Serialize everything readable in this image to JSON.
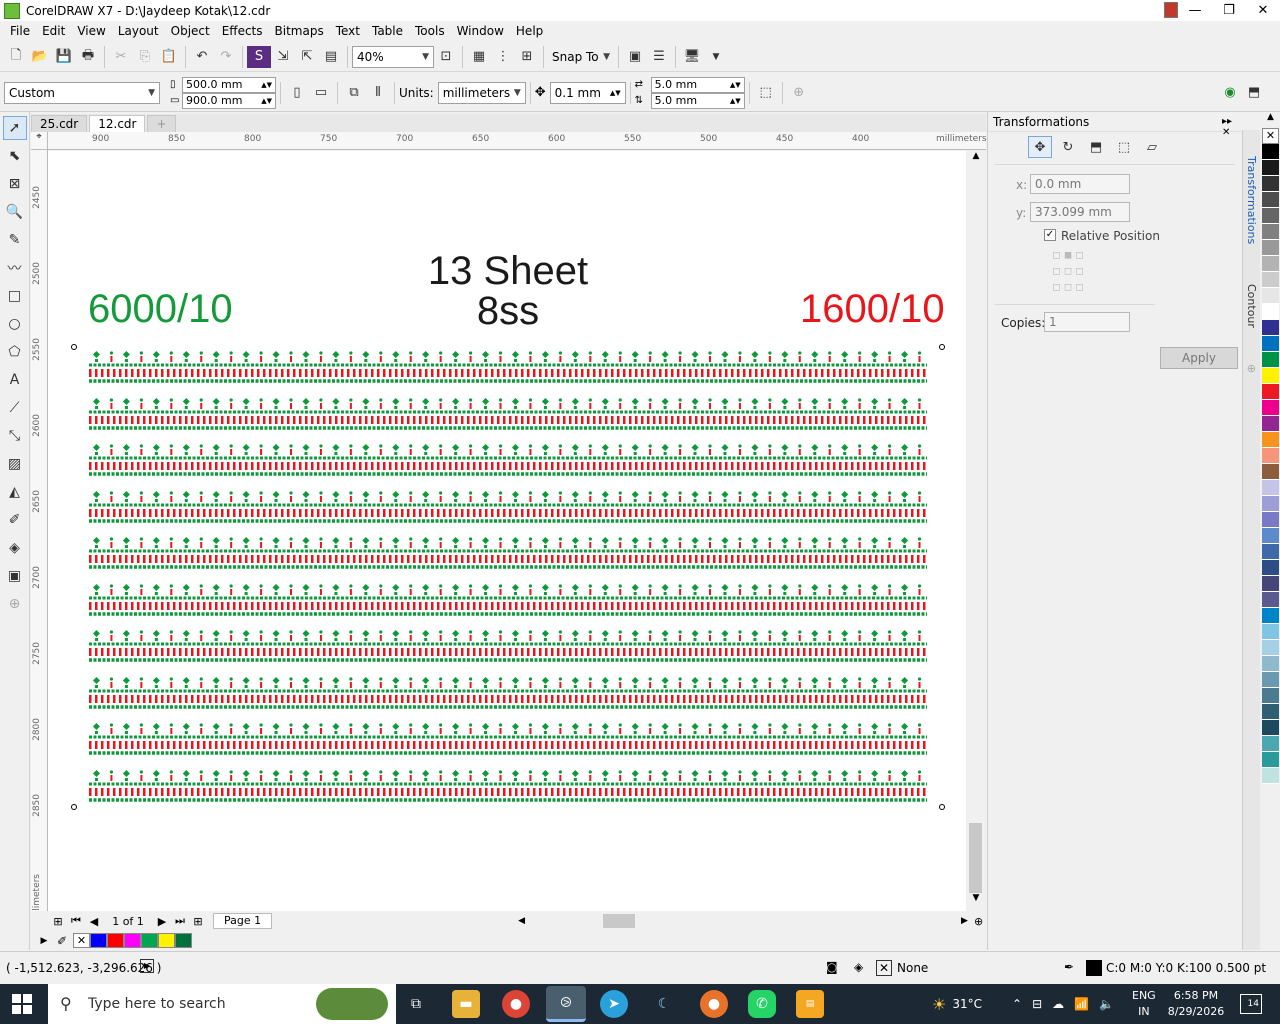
{
  "window": {
    "title": "CorelDRAW X7 - D:\\Jaydeep Kotak\\12.cdr",
    "minimize_glyph": "—",
    "restore_glyph": "❐",
    "close_glyph": "✕"
  },
  "menu": [
    "File",
    "Edit",
    "View",
    "Layout",
    "Object",
    "Effects",
    "Bitmaps",
    "Text",
    "Table",
    "Tools",
    "Window",
    "Help"
  ],
  "toolbar1": {
    "zoom_value": "40%",
    "snap_to_label": "Snap To"
  },
  "toolbar2": {
    "page_preset": "Custom",
    "page_width": "500.0 mm",
    "page_height": "900.0 mm",
    "units_label": "Units:",
    "units_value": "millimeters",
    "nudge_value": "0.1 mm",
    "dup_x": "5.0 mm",
    "dup_y": "5.0 mm"
  },
  "doc_tabs": [
    "25.cdr",
    "12.cdr"
  ],
  "hruler": {
    "labels": [
      "900",
      "850",
      "800",
      "750",
      "700",
      "650",
      "600",
      "550",
      "500",
      "450",
      "400"
    ],
    "unit": "millimeters"
  },
  "vruler": {
    "labels": [
      "2450",
      "2500",
      "2550",
      "2600",
      "2650",
      "2700",
      "2750",
      "2800",
      "2850"
    ],
    "unit": "millimeters"
  },
  "canvas": {
    "heading_line1": "13 Sheet",
    "heading_line2": "8ss",
    "left_label": "6000/10",
    "right_label": "1600/10",
    "left_label_color": "#149a3a",
    "right_label_color": "#e8161b",
    "pattern_green": "#0e9a3a",
    "pattern_red": "#e8161b",
    "pattern_row_count": 10
  },
  "page_nav": {
    "page_count_text": "1 of 1",
    "page_tab": "Page 1"
  },
  "docker": {
    "title": "Transformations",
    "x_label": "x:",
    "x_value": "0.0 mm",
    "y_label": "y:",
    "y_value": "373.099 mm",
    "relative_position": "Relative Position",
    "copies_label": "Copies:",
    "copies_value": "1",
    "apply_label": "Apply",
    "side_tabs": [
      "Transformations",
      "Contour"
    ]
  },
  "palette_colors": [
    "#000000",
    "#1a1a1a",
    "#333333",
    "#4d4d4d",
    "#666666",
    "#808080",
    "#999999",
    "#b3b3b3",
    "#cccccc",
    "#e6e6e6",
    "#ffffff",
    "#2e3192",
    "#0071bc",
    "#009245",
    "#fff200",
    "#ed1c24",
    "#ec008c",
    "#92278f",
    "#f7941d",
    "#f69679",
    "#8b5e3c",
    "#c4c4e6",
    "#9e9ed6",
    "#7a7ac4",
    "#5b8bc9",
    "#3e6aa8",
    "#2d4e85",
    "#46467a",
    "#5a5a8c",
    "#0084c8",
    "#7fc6e4",
    "#a6d0e4",
    "#8fb9cc",
    "#6a9ab0",
    "#4b7b90",
    "#2f5f73",
    "#1d4a5c",
    "#4ba8b0",
    "#2a9a9a",
    "#bfe3e0"
  ],
  "doc_palette": [
    "#0000ff",
    "#ff0000",
    "#ff00ff",
    "#00a651",
    "#fff200",
    "#00703c"
  ],
  "status": {
    "coords": "( -1,512.623, -3,296.626 )",
    "fill_label": "None",
    "outline_label": "C:0 M:0 Y:0 K:100  0.500 pt"
  },
  "taskbar": {
    "search_placeholder": "Type here to search",
    "weather": "31°C",
    "language_line1": "ENG",
    "language_line2": "IN",
    "time": "6:58 PM",
    "date": "8/29/2026",
    "notification_count": "14"
  }
}
